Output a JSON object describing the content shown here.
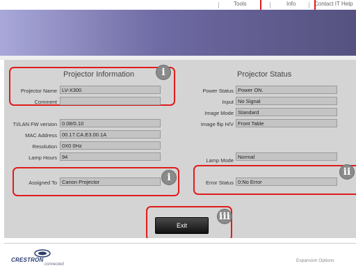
{
  "nav": {
    "tools": "Tools",
    "info": "Info",
    "contact": "Contact IT Help"
  },
  "projector_info": {
    "title": "Projector Information",
    "name_label": "Projector Name",
    "name_value": "LV-X300",
    "comment_label": "Comment",
    "comment_value": "",
    "fw_label": "TI/LAN FW version",
    "fw_value": "0.08/0.10",
    "mac_label": "MAC Address",
    "mac_value": "00.17.CA.E3.00.1A",
    "res_label": "Resolution",
    "res_value": "0X0 0Hz",
    "lamp_hours_label": "Lamp Hours",
    "lamp_hours_value": "94",
    "assigned_label": "Assigned To",
    "assigned_value": "Canon Projector"
  },
  "projector_status": {
    "title": "Projector Status",
    "power_label": "Power Status",
    "power_value": "Power ON.",
    "input_label": "Input",
    "input_value": "No Signal",
    "image_mode_label": "Image Mode",
    "image_mode_value": "Standard",
    "flip_label": "Image flip H/V",
    "flip_value": "Front Table",
    "lamp_mode_label": "Lamp Mode",
    "lamp_mode_value": "Normal",
    "error_label": "Error Status",
    "error_value": "0:No Error"
  },
  "badges": {
    "i": "i",
    "ii": "ii",
    "iii": "iii"
  },
  "exit_label": "Exit",
  "footer": {
    "logo_text": "CRESTRON",
    "logo_sub": "connected",
    "expansion": "Expansion Options"
  },
  "colors": {
    "callout": "#e01b1b",
    "badge": "#8a8a8a",
    "banner_start": "#a9a8d9",
    "banner_end": "#55517f"
  }
}
